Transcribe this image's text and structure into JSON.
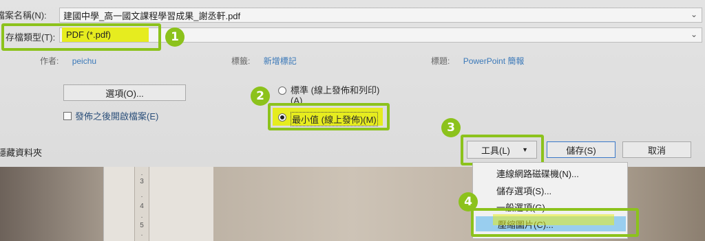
{
  "file_name": {
    "label": "檔案名稱(N):",
    "value": "建國中學_高一國文課程學習成果_謝丞軒.pdf"
  },
  "file_type": {
    "label": "存檔類型(T):",
    "value": "PDF (*.pdf)"
  },
  "meta": {
    "author_key": "作者:",
    "author_value": "peichu",
    "tags_key": "標籤:",
    "tags_value": "新增標記",
    "title_key": "標題:",
    "title_value": "PowerPoint 簡報"
  },
  "options_button": "選項(O)...",
  "open_after_publish": "發佈之後開啟檔案(E)",
  "optimize": {
    "standard_label": "標準 (線上發佈和列印)",
    "standard_key": "(A)",
    "minimum_label": "最小值 (線上發佈)(M)"
  },
  "folder_label": "隱藏資料夾",
  "tools_button": "工具(L)",
  "save_button": "儲存(S)",
  "cancel_button": "取消",
  "ruler_ticks": [
    "3",
    "4",
    "5"
  ],
  "tools_menu": [
    "連線網路磁碟機(N)...",
    "儲存選項(S)...",
    "一般選項(G)...",
    "壓縮圖片(C)..."
  ],
  "badges": [
    "1",
    "2",
    "3",
    "4"
  ],
  "colors": {
    "highlight_green": "#8cc21c",
    "highlight_yellow": "#e6ec1f",
    "menu_selected": "#99ceef"
  }
}
